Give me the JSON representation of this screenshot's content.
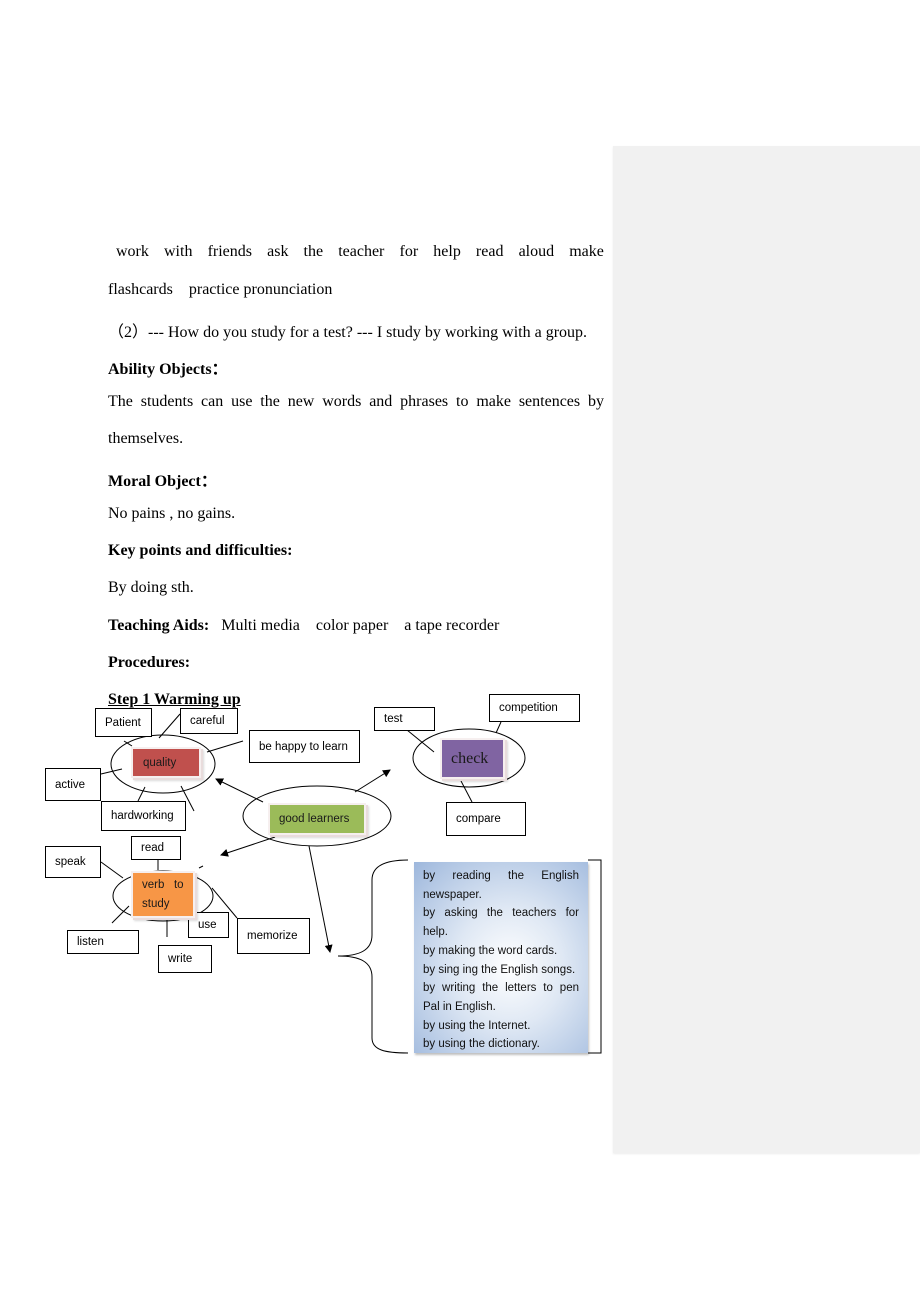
{
  "document": {
    "line1_words": [
      "work",
      "with",
      "friends",
      "ask",
      "the",
      "teacher",
      "for",
      "help",
      "read",
      "aloud",
      "make"
    ],
    "line2": "flashcards    practice pronunciation",
    "line3": "（2）--- How do you study for a test? --- I study by working with a group.",
    "ability_heading": "Ability Objects：",
    "ability_line1_words": [
      "The",
      "students",
      "can",
      "use",
      "the",
      "new",
      "words",
      "and",
      "phrases",
      "to",
      "make",
      "sentences",
      "by"
    ],
    "ability_line2": "themselves.",
    "moral_heading": "Moral Object：",
    "moral_text": "No pains , no gains.",
    "key_heading": "Key points and difficulties:",
    "key_text": "By doing sth.",
    "aids_heading": "Teaching Aids:",
    "aids_text": "   Multi media    color paper    a tape recorder",
    "procedures_heading": "Procedures:",
    "step1_heading": "Step 1 Warming up"
  },
  "diagram": {
    "center": {
      "label": "good learners",
      "color": "#9bbb59"
    },
    "quality": {
      "label": "quality",
      "color": "#c0504d",
      "satellites": [
        "Patient",
        "careful",
        "be happy to learn",
        "active",
        "hardworking"
      ]
    },
    "check": {
      "label": "check",
      "color": "#8064a2",
      "satellites": [
        "test",
        "competition",
        "compare"
      ]
    },
    "verb": {
      "label_line1": "verb   to",
      "label_line2": "study",
      "color": "#f79646",
      "satellites": [
        "read",
        "speak",
        "listen",
        "use",
        "write",
        "memorize"
      ]
    },
    "methods": [
      "by reading the English newspaper.",
      "by asking the teachers for help.",
      "by making the word cards.",
      "by sing ing the English songs.",
      "by writing the letters to pen Pal in English.",
      "by using the Internet.",
      "by using the dictionary."
    ]
  },
  "comment_pane": {
    "background": "#f1f1f1"
  }
}
